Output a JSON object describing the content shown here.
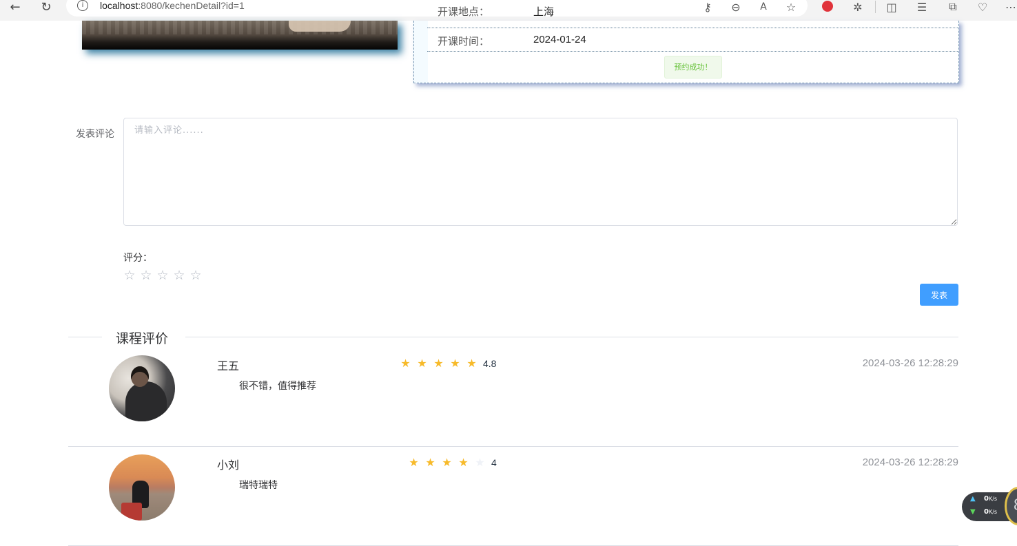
{
  "browser": {
    "url_host": "localhost",
    "url_rest": ":8080/kechenDetail?id=1",
    "info_icon": "i",
    "toolbar_icons": [
      "back-icon",
      "refresh-icon",
      "key-icon",
      "zoom-out-icon",
      "read-aloud-icon",
      "favorite-star-icon",
      "extension-red-icon",
      "extensions-puzzle-icon",
      "split-screen-icon",
      "favorites-list-icon",
      "collections-icon",
      "browser-essentials-icon",
      "more-icon"
    ]
  },
  "course_info": {
    "location_label": "开课地点：",
    "location_value": "上海",
    "time_label": "开课时间：",
    "time_value": "2024-01-24",
    "success_message": "预约成功！"
  },
  "comment_form": {
    "label": "发表评论",
    "placeholder": "请输入评论......",
    "value": "",
    "rating_label": "评分：",
    "rating_value": 0,
    "rating_max": 5,
    "submit_label": "发表"
  },
  "reviews_section": {
    "title": "课程评价",
    "reviews": [
      {
        "name": "王五",
        "rating": 4.8,
        "rating_text": "4.8",
        "date": "2024-03-26 12:28:29",
        "text": "很不错，值得推荐"
      },
      {
        "name": "小刘",
        "rating": 4,
        "rating_text": "4",
        "date": "2024-03-26 12:28:29",
        "text": "瑞特瑞特"
      }
    ]
  },
  "network_widget": {
    "upload_speed": "0",
    "download_speed": "0",
    "unit": "K/s",
    "gauge_value": "8"
  },
  "colors": {
    "primary_button": "#409eff",
    "star_active": "#f7ba2a",
    "success_bg": "#f0f9eb",
    "success_text": "#67c23a"
  }
}
